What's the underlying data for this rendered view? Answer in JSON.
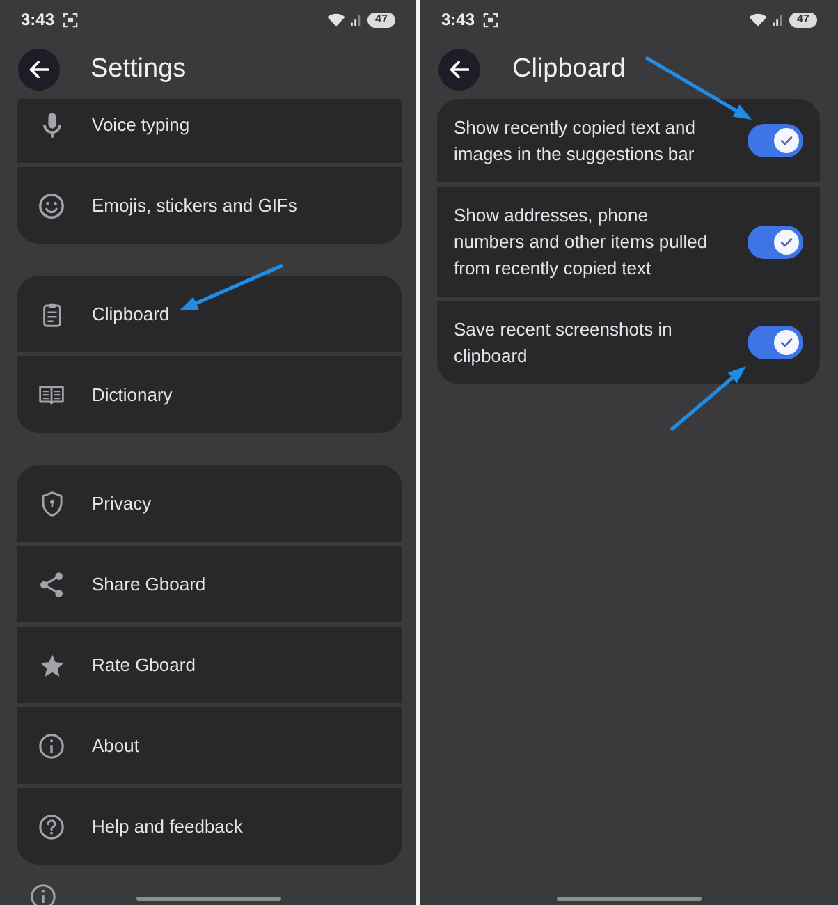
{
  "settings_screen": {
    "status_bar": {
      "time": "3:43",
      "battery": "47"
    },
    "header": {
      "title": "Settings"
    },
    "groups": [
      {
        "items": [
          {
            "label": "Voice typing"
          },
          {
            "label": "Emojis, stickers and GIFs"
          }
        ]
      },
      {
        "items": [
          {
            "label": "Clipboard"
          },
          {
            "label": "Dictionary"
          }
        ]
      },
      {
        "items": [
          {
            "label": "Privacy"
          },
          {
            "label": "Share Gboard"
          },
          {
            "label": "Rate Gboard"
          },
          {
            "label": "About"
          },
          {
            "label": "Help and feedback"
          }
        ]
      }
    ]
  },
  "clipboard_screen": {
    "status_bar": {
      "time": "3:43",
      "battery": "47"
    },
    "header": {
      "title": "Clipboard"
    },
    "settings": [
      {
        "label": "Show recently copied text and images in the suggestions bar",
        "on": true
      },
      {
        "label": "Show addresses, phone numbers and other items pulled from recently copied text",
        "on": true
      },
      {
        "label": "Save recent screenshots in clipboard",
        "on": true
      }
    ]
  }
}
